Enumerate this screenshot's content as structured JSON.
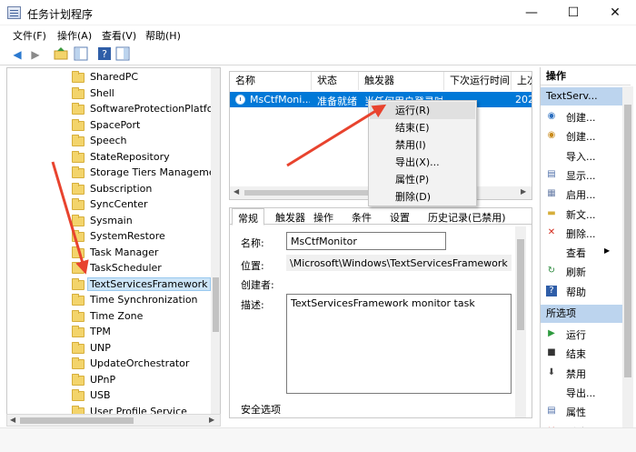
{
  "window": {
    "title": "任务计划程序",
    "minimize": "—",
    "maximize": "☐",
    "close": "✕"
  },
  "menu": [
    "文件(F)",
    "操作(A)",
    "查看(V)",
    "帮助(H)"
  ],
  "tree": {
    "items": [
      "SharedPC",
      "Shell",
      "SoftwareProtectionPlatform",
      "SpacePort",
      "Speech",
      "StateRepository",
      "Storage Tiers Management",
      "Subscription",
      "SyncCenter",
      "Sysmain",
      "SystemRestore",
      "Task Manager",
      "TaskScheduler",
      "TextServicesFramework",
      "Time Synchronization",
      "Time Zone",
      "TPM",
      "UNP",
      "UpdateOrchestrator",
      "UPnP",
      "USB",
      "User Profile Service"
    ],
    "selected_index": 13
  },
  "tasks": {
    "columns": [
      "名称",
      "状态",
      "触发器",
      "下次运行时间",
      "上次"
    ],
    "rows": [
      {
        "name": "MsCtfMoni...",
        "status": "准备就绪",
        "trigger": "当任何用户登录时",
        "next": "",
        "last": "202"
      }
    ]
  },
  "context_menu": {
    "items": [
      "运行(R)",
      "结束(E)",
      "禁用(I)",
      "导出(X)...",
      "属性(P)",
      "删除(D)"
    ],
    "hover_index": 0
  },
  "detail": {
    "tabs": [
      "常规",
      "触发器",
      "操作",
      "条件",
      "设置",
      "历史记录(已禁用)"
    ],
    "active_tab": 0,
    "name_label": "名称:",
    "name_value": "MsCtfMonitor",
    "location_label": "位置:",
    "location_value": "\\Microsoft\\Windows\\TextServicesFramework",
    "author_label": "创建者:",
    "author_value": "",
    "desc_label": "描述:",
    "desc_value": "TextServicesFramework monitor task",
    "security_label": "安全选项"
  },
  "actions": {
    "header": "操作",
    "section1": "TextServ...",
    "items1": [
      {
        "icon": "create-basic-task-icon",
        "label": "创建..."
      },
      {
        "icon": "create-task-icon",
        "label": "创建..."
      },
      {
        "icon": "",
        "label": "导入..."
      },
      {
        "icon": "display-icon",
        "label": "显示..."
      },
      {
        "icon": "enable-icon",
        "label": "启用..."
      },
      {
        "icon": "new-folder-icon",
        "label": "新文..."
      },
      {
        "icon": "delete-icon",
        "label": "删除..."
      },
      {
        "icon": "",
        "label": "查看"
      },
      {
        "icon": "refresh-icon",
        "label": "刷新"
      },
      {
        "icon": "help-icon",
        "label": "帮助"
      }
    ],
    "section2": "所选项",
    "items2": [
      {
        "icon": "run-icon",
        "label": "运行"
      },
      {
        "icon": "stop-icon",
        "label": "结束"
      },
      {
        "icon": "disable-icon",
        "label": "禁用"
      },
      {
        "icon": "",
        "label": "导出..."
      },
      {
        "icon": "properties-icon",
        "label": "属性"
      },
      {
        "icon": "delete-icon",
        "label": "删除"
      }
    ]
  },
  "colors": {
    "selection": "#0078d7",
    "band": "#bcd4ee",
    "annotation_arrow": "#e8432e"
  }
}
